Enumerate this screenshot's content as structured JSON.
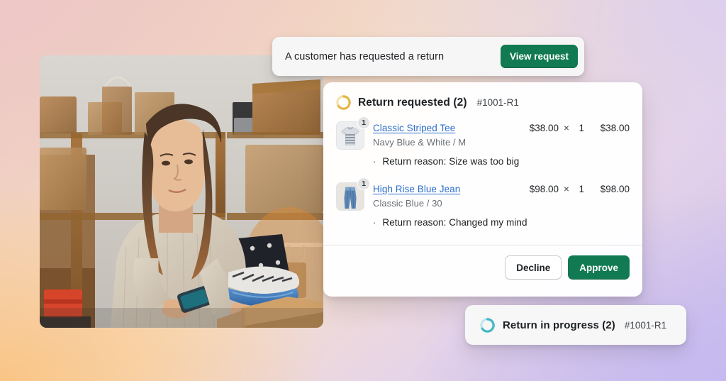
{
  "background": {
    "gradient_colors": [
      "#eec8c3",
      "#f2d5c2",
      "#f6dfc9",
      "#e6d4e8",
      "#c9bcea"
    ]
  },
  "photo": {
    "alt": "Warehouse worker holding a phone and folded returned clothing over an open cardboard box"
  },
  "toast_request": {
    "message": "A customer has requested a return",
    "button_label": "View request",
    "button_color": "#117a53"
  },
  "return_card": {
    "status_label": "Return requested (2)",
    "order_id": "#1001-R1",
    "status_color": "#e3b84b",
    "items": [
      {
        "title": "Classic Striped Tee",
        "variant": "Navy Blue & White / M",
        "quantity_badge": "1",
        "unit_price": "$38.00",
        "times": "×",
        "quantity": "1",
        "total": "$38.00",
        "reason": "Return reason: Size was too big",
        "thumb": "striped-tee-image"
      },
      {
        "title": "High Rise Blue Jean",
        "variant": "Classic Blue / 30",
        "quantity_badge": "1",
        "unit_price": "$98.00",
        "times": "×",
        "quantity": "1",
        "total": "$98.00",
        "reason": "Return reason: Changed my mind",
        "thumb": "blue-jean-image"
      }
    ],
    "decline_label": "Decline",
    "approve_label": "Approve",
    "approve_color": "#117a53"
  },
  "toast_progress": {
    "status_label": "Return in progress (2)",
    "order_id": "#1001-R1",
    "status_color": "#45b8c4"
  }
}
